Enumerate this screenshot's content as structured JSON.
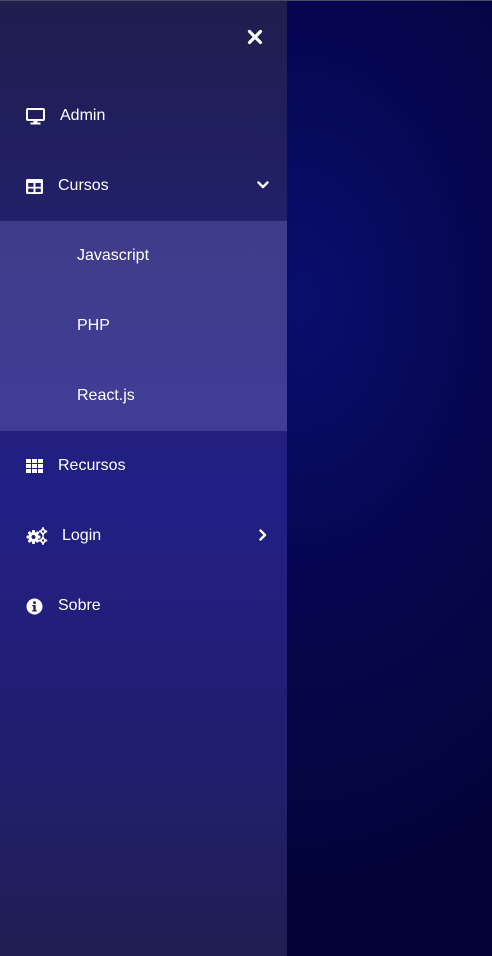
{
  "sidebar": {
    "close_icon": "close-icon",
    "items": [
      {
        "label": "Admin",
        "icon": "desktop-icon"
      },
      {
        "label": "Cursos",
        "icon": "table-icon",
        "chevron": "chevron-down-icon",
        "submenu": [
          {
            "label": "Javascript"
          },
          {
            "label": "PHP"
          },
          {
            "label": "React.js"
          }
        ]
      },
      {
        "label": "Recursos",
        "icon": "grid-icon"
      },
      {
        "label": "Login",
        "icon": "gears-icon",
        "chevron": "chevron-right-icon"
      },
      {
        "label": "Sobre",
        "icon": "info-circle-icon"
      }
    ]
  },
  "colors": {
    "sidebar_bg": "#221f70",
    "submenu_bg": "#3a3878",
    "page_bg": "#060650",
    "text": "#ffffff"
  }
}
